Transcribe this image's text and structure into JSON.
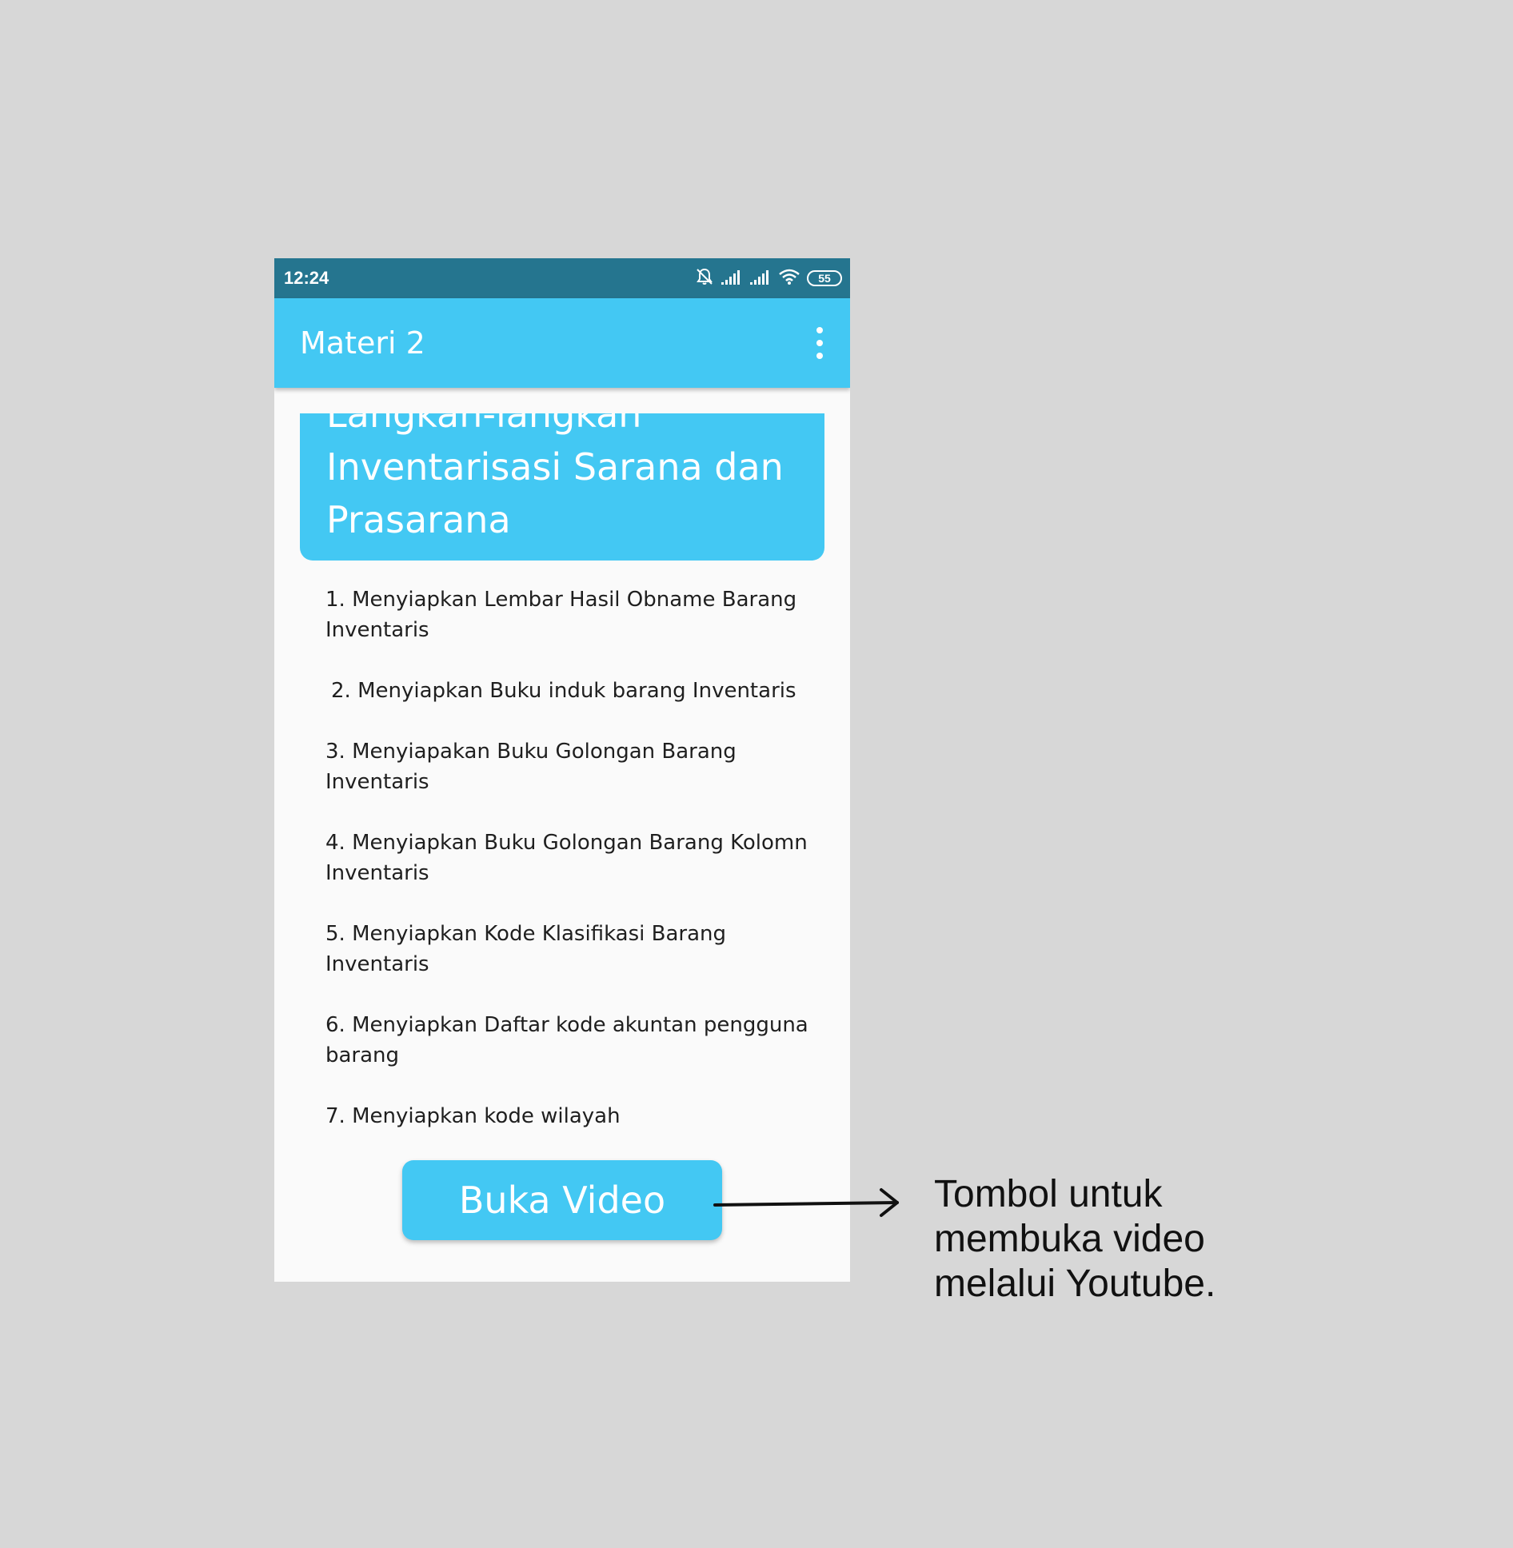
{
  "status_bar": {
    "time": "12:24",
    "battery": "55",
    "icons": [
      "bell-off-icon",
      "signal-icon",
      "signal-icon",
      "wifi-icon",
      "battery-icon"
    ]
  },
  "app_bar": {
    "title": "Materi 2",
    "menu_icon": "more-vert-icon"
  },
  "header_card": {
    "partial_line": "Langkah-langkah",
    "title": "Inventarisasi Sarana dan Prasarana"
  },
  "steps": [
    "1. Menyiapkan Lembar Hasil Obname Barang Inventaris",
    "2. Menyiapkan Buku induk barang Inventaris",
    "3. Menyiapakan Buku Golongan Barang Inventaris",
    "4. Menyiapkan Buku Golongan Barang Kolomn Inventaris",
    "5. Menyiapkan Kode Klasifikasi Barang Inventaris",
    "6. Menyiapkan Daftar kode akuntan pengguna barang",
    "7. Menyiapkan kode wilayah"
  ],
  "video_button": {
    "label": "Buka Video"
  },
  "annotation": {
    "text": "Tombol untuk\nmembuka video\nmelalui Youtube."
  },
  "colors": {
    "status_bar": "#25758f",
    "accent": "#43c8f3",
    "background": "#d7d7d7",
    "content_bg": "#fafafa"
  }
}
